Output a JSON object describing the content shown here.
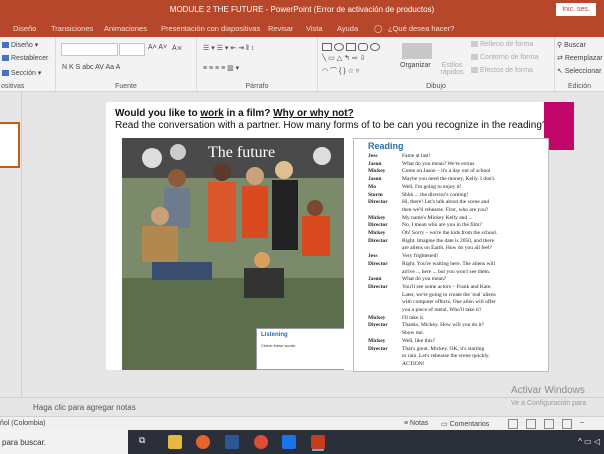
{
  "window": {
    "title": "MODULE 2 THE FUTURE  -  PowerPoint (Error de activación de productos)",
    "signin": "Inic. ses."
  },
  "tabs": [
    {
      "label": "Diseño",
      "active": false
    },
    {
      "label": "Transiciones",
      "active": false
    },
    {
      "label": "Animaciones",
      "active": false
    },
    {
      "label": "Presentación con diapositivas",
      "active": false
    },
    {
      "label": "Revisar",
      "active": false
    },
    {
      "label": "Vista",
      "active": false
    },
    {
      "label": "Ayuda",
      "active": false
    },
    {
      "label": "¿Qué desea hacer?",
      "active": false
    }
  ],
  "ribbon": {
    "slides": {
      "diseno": "Diseño",
      "restablecer": "Restablecer",
      "seccion": "Sección",
      "label": "ositivas"
    },
    "font": {
      "format": "N  K  S  abc  AV  Aa  A",
      "label": "Fuente"
    },
    "paragraph": {
      "label": "Párrafo"
    },
    "drawing": {
      "organize": "Organizar",
      "quick": "Estilos rápidos",
      "fill": "Relleno de forma",
      "outline": "Contorno de forma",
      "effects": "Efectos de forma",
      "label": "Dibujo"
    },
    "editing": {
      "find": "Buscar",
      "replace": "Reemplazar",
      "select": "Seleccionar",
      "label": "Edición"
    }
  },
  "slide": {
    "q1_a": "Would you like to ",
    "q1_b": "work",
    "q1_c": " in a film? ",
    "q1_d": "Why or why not?",
    "q2": "Read the conversation with a partner. How many forms of to be can you recognize in the reading?",
    "photo_title": "The future",
    "listening_title": "Listening",
    "listening_sub": "Check these words.",
    "reading_title": "Reading",
    "reading_lines": [
      {
        "speaker": "Jess",
        "text": "Fame at last!"
      },
      {
        "speaker": "Jason",
        "text": "What do you mean? We're extras"
      },
      {
        "speaker": "Mickey",
        "text": "Come on Jason – it's a day out of school"
      },
      {
        "speaker": "Jason",
        "text": "Maybe you need the money, Kelly. I don't."
      },
      {
        "speaker": "Mo",
        "text": "Well, I'm going to enjoy it!"
      },
      {
        "speaker": "Storm",
        "text": "Shhh ... the director's coming!"
      },
      {
        "speaker": "Director",
        "text": "Hi, there! Let's talk about the scene and"
      },
      {
        "speaker": "",
        "text": "then we'll rehearse. First, who are you?"
      },
      {
        "speaker": "Mickey",
        "text": "My name's Mickey Kelly and ..."
      },
      {
        "speaker": "Director",
        "text": "No, I mean who are you in the film?"
      },
      {
        "speaker": "Mickey",
        "text": "Oh! Sorry – we're the kids from the school."
      },
      {
        "speaker": "Director",
        "text": "Right. Imagine the date is 2050, and there"
      },
      {
        "speaker": "",
        "text": "are aliens on Earth. How do you all feel?"
      },
      {
        "speaker": "Jess",
        "text": "Very frightened!"
      },
      {
        "speaker": "Director",
        "text": "Right. You're waiting here. The aliens will"
      },
      {
        "speaker": "",
        "text": "arrive ... here ... but you won't see them."
      },
      {
        "speaker": "Jason",
        "text": "What do you mean?"
      },
      {
        "speaker": "Director",
        "text": "You'll see some actors – Frank and Kate."
      },
      {
        "speaker": "",
        "text": "Later, we're going to create the 'real' aliens"
      },
      {
        "speaker": "",
        "text": "with computer effects. One alien will offer"
      },
      {
        "speaker": "",
        "text": "you a piece of metal. Who'll take it?"
      },
      {
        "speaker": "Mickey",
        "text": "I'll take it."
      },
      {
        "speaker": "Director",
        "text": "Thanks, Mickey. How will you do it?"
      },
      {
        "speaker": "",
        "text": "Show me."
      },
      {
        "speaker": "Mickey",
        "text": "Well, like this?"
      },
      {
        "speaker": "Director",
        "text": "That's great, Mickey. OK, it's starting"
      },
      {
        "speaker": "",
        "text": "to rain. Let's rehearse the scene quickly."
      },
      {
        "speaker": "",
        "text": "ACTION!"
      }
    ]
  },
  "notes_placeholder": "Haga clic para agregar notas",
  "watermark": {
    "line1": "Activar Windows",
    "line2": "Ve a Configuración para"
  },
  "status": {
    "language": "ñol (Colombia)",
    "notes": "Notas",
    "comments": "Comentarios"
  },
  "taskbar": {
    "search": "para buscar."
  },
  "colors": {
    "accent": "#b7472a",
    "slide_accent": "#c10569",
    "reading_title": "#2a6db0"
  }
}
